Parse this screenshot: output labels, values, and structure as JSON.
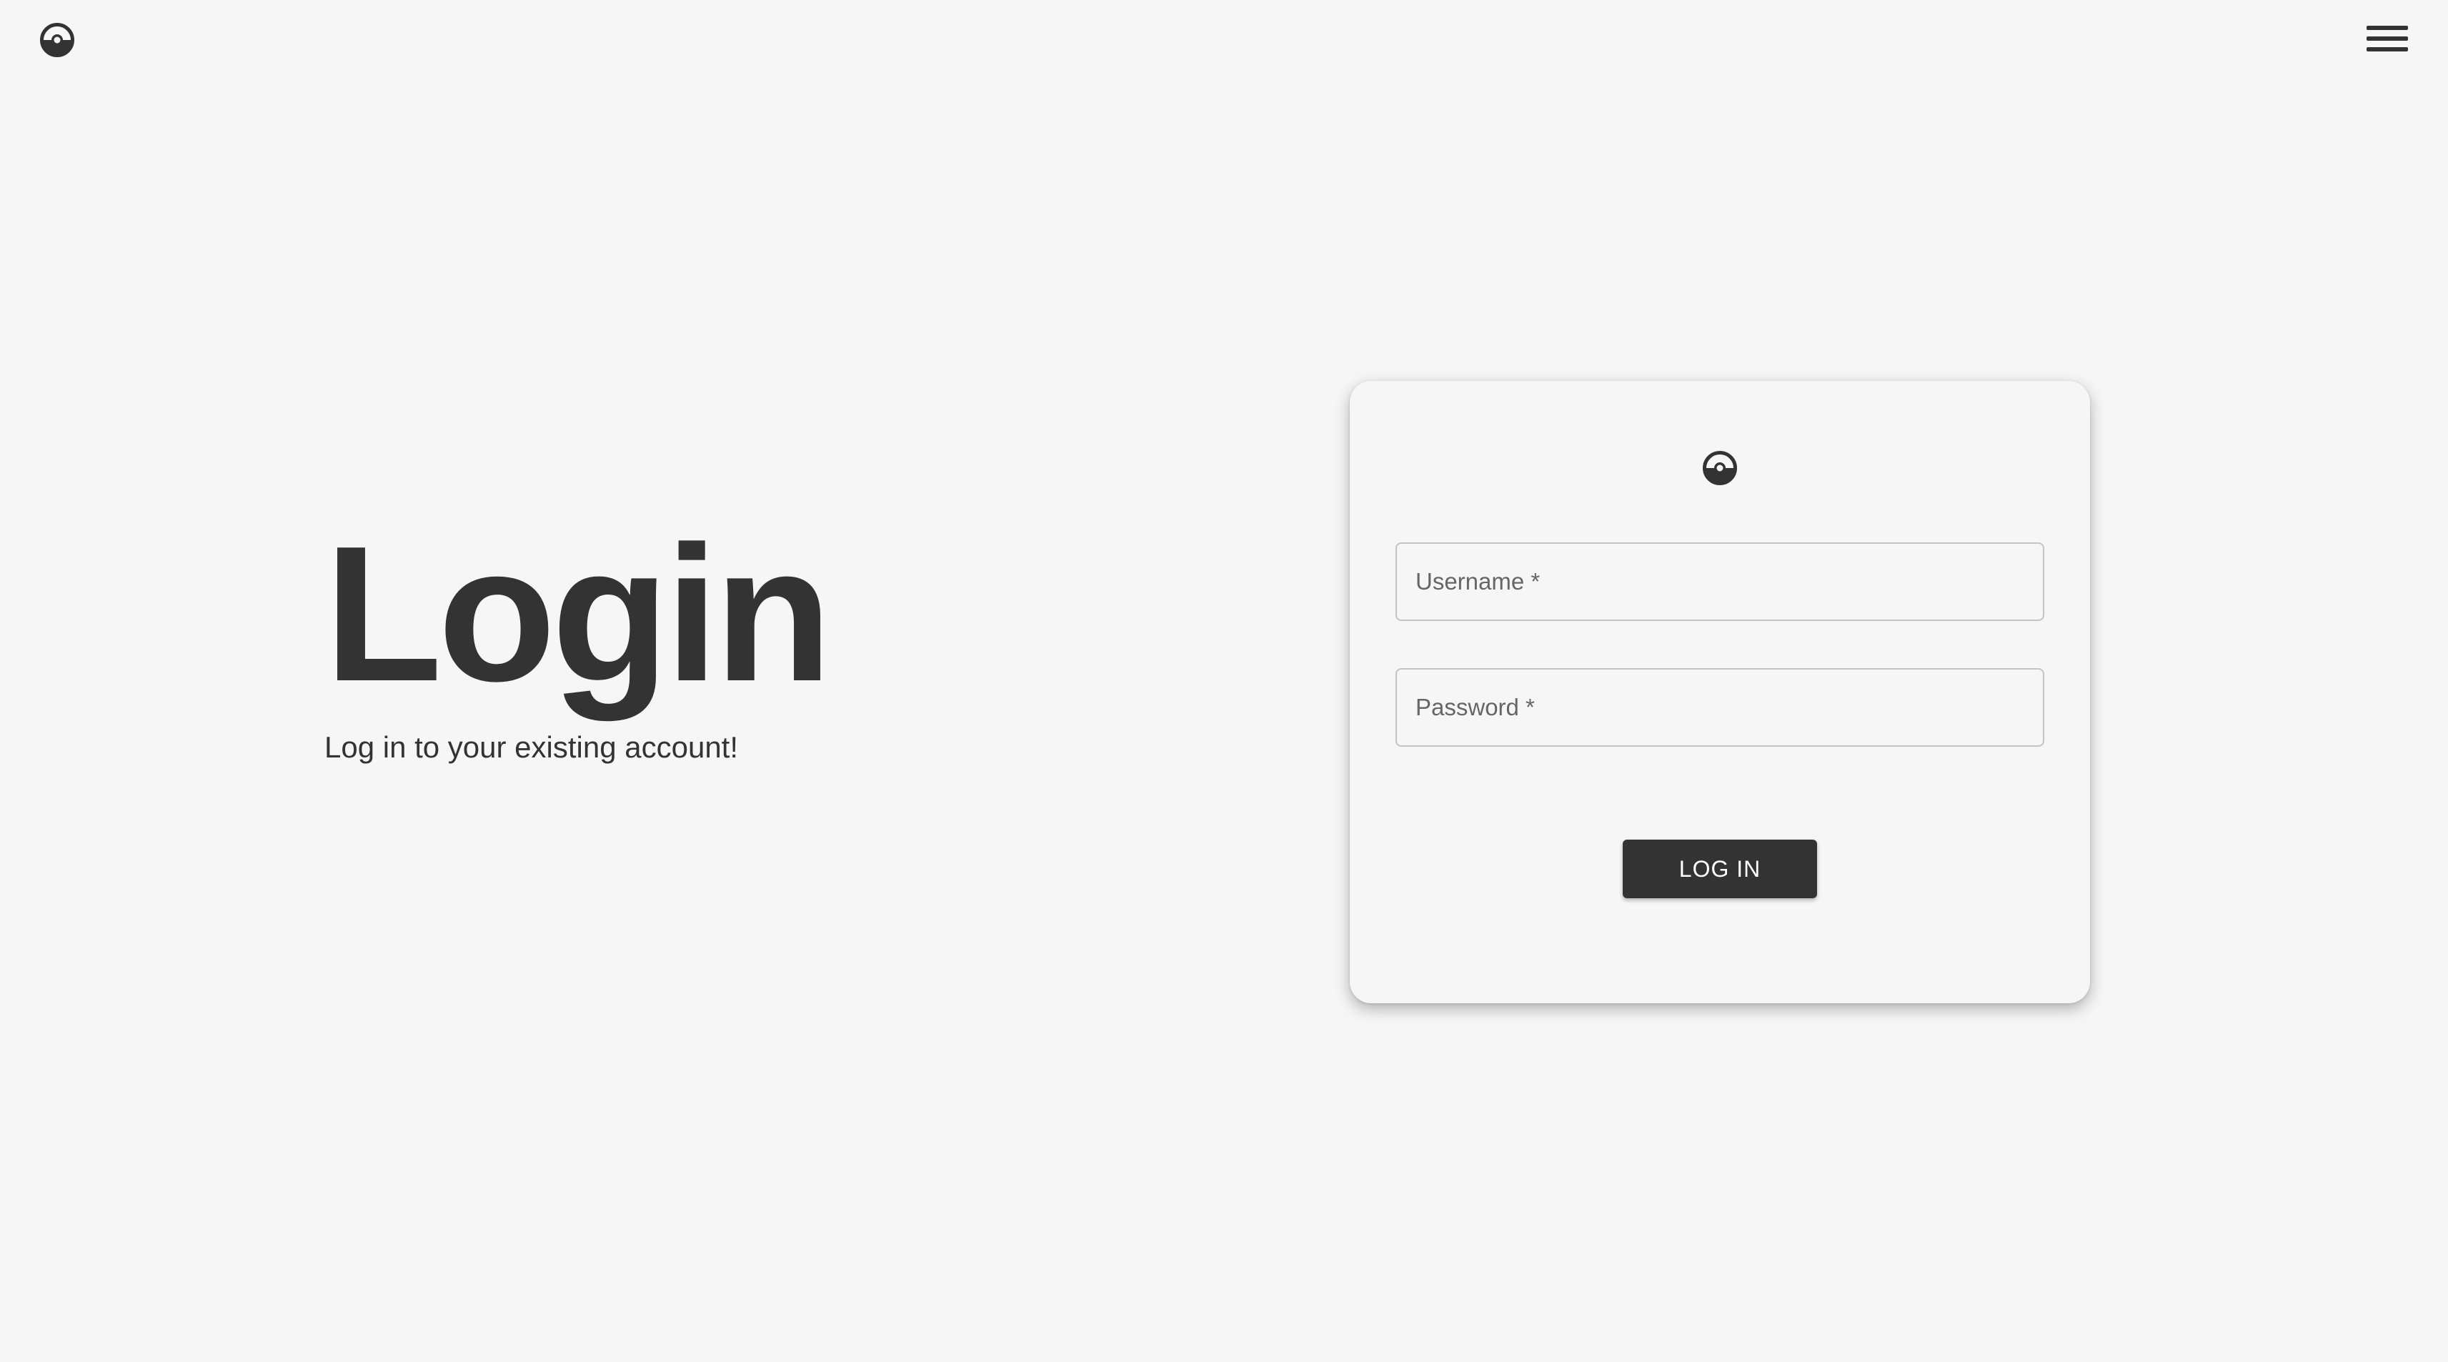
{
  "header": {
    "logo_icon": "pokeball-icon",
    "menu_icon": "hamburger-menu-icon"
  },
  "hero": {
    "title": "Login",
    "subtitle": "Log in to your existing account!"
  },
  "login_form": {
    "logo_icon": "pokeball-icon",
    "username": {
      "value": "",
      "placeholder": "Username *"
    },
    "password": {
      "value": "",
      "placeholder": "Password *"
    },
    "submit_label": "LOG IN"
  },
  "colors": {
    "background": "#f6f6f6",
    "text": "#333333",
    "button_background": "#333333",
    "button_text": "#ffffff",
    "field_border": "#c4c4c4"
  }
}
